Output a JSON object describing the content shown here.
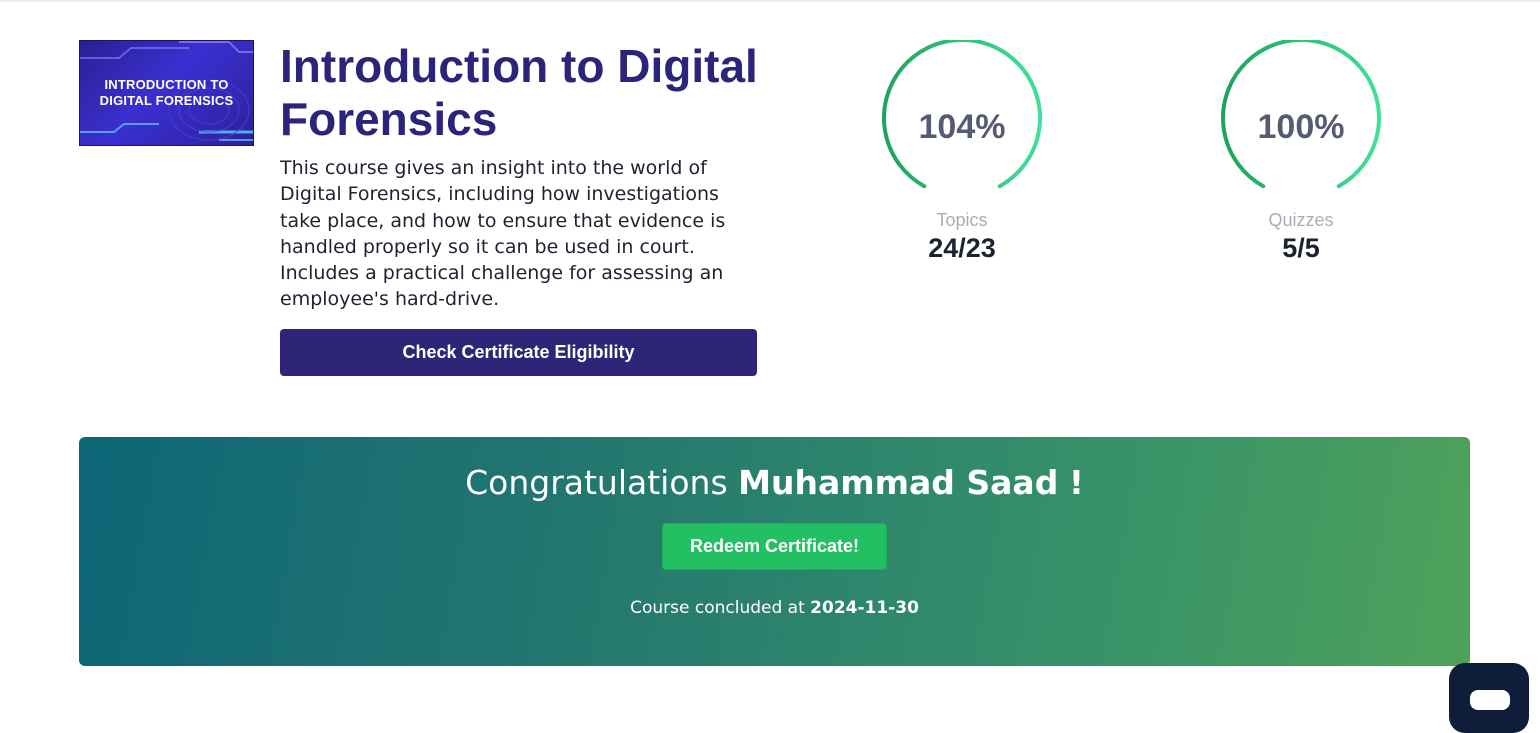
{
  "course": {
    "thumbnail_text": "INTRODUCTION TO DIGITAL FORENSICS",
    "title": "Introduction to Digital Forensics",
    "description": "This course gives an insight into the world of Digital Forensics, including how investigations take place, and how to ensure that evidence is handled properly so it can be used in court. Includes a practical challenge for assessing an employee's hard-drive.",
    "check_button_label": "Check Certificate Eligibility"
  },
  "stats": [
    {
      "percent_label": "104%",
      "label": "Topics",
      "value": "24/23",
      "fill": 1.0
    },
    {
      "percent_label": "100%",
      "label": "Quizzes",
      "value": "5/5",
      "fill": 1.0
    }
  ],
  "banner": {
    "greeting": "Congratulations",
    "name": "Muhammad Saad",
    "suffix": "!",
    "redeem_label": "Redeem Certificate!",
    "concluded_prefix": "Course concluded at",
    "concluded_date": "2024-11-30"
  },
  "colors": {
    "title": "#2c237a",
    "primary_button": "#2e2478",
    "ring_start": "#1fa35a",
    "ring_end": "#3fe09a",
    "redeem_button": "#22c063",
    "banner_start": "#0d6676",
    "banner_end": "#4ea25a"
  },
  "icons": {
    "chat": "chat-bubble-icon"
  }
}
